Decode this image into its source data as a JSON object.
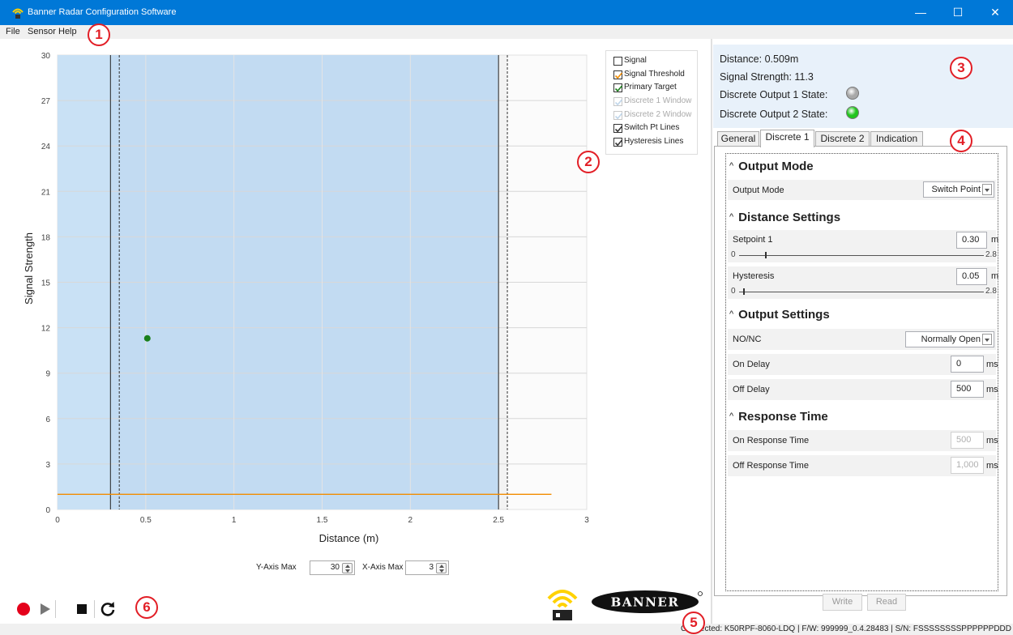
{
  "window": {
    "title": "Banner Radar Configuration Software",
    "minimize": "—",
    "maximize": "☐",
    "close": "✕"
  },
  "menu": [
    "File",
    "Sensor",
    "Help"
  ],
  "badges": [
    "1",
    "2",
    "3",
    "4",
    "5",
    "6"
  ],
  "chart_data": {
    "type": "scatter",
    "xlabel": "Distance (m)",
    "ylabel": "Signal Strength",
    "xlim": [
      0,
      3
    ],
    "ylim": [
      0,
      30
    ],
    "x_ticks": [
      "0",
      "0.5",
      "1",
      "1.5",
      "2",
      "2.5",
      "3"
    ],
    "y_ticks": [
      "0",
      "3",
      "6",
      "9",
      "12",
      "15",
      "18",
      "21",
      "24",
      "27",
      "30"
    ],
    "grid": true,
    "points": [
      {
        "x": 0.509,
        "y": 11.3,
        "color": "#1a7f1a"
      }
    ],
    "signal_threshold": {
      "value": 1.0,
      "x_range": [
        0,
        2.8
      ],
      "color": "#f28c00"
    },
    "window_range": [
      0.3,
      2.5
    ],
    "switch_point_lines": [
      0.3,
      2.5
    ],
    "hysteresis_lines": [
      0.35,
      2.55
    ],
    "window_color": "#c9e1f5"
  },
  "legend": [
    {
      "label": "Signal",
      "checked": false,
      "enabled": true,
      "check_color": "#333"
    },
    {
      "label": "Signal Threshold",
      "checked": true,
      "enabled": true,
      "check_color": "#f28c00"
    },
    {
      "label": "Primary Target",
      "checked": true,
      "enabled": true,
      "check_color": "#1a7f1a"
    },
    {
      "label": "Discrete 1 Window",
      "checked": true,
      "enabled": false,
      "check_color": "#c0d6ea"
    },
    {
      "label": "Discrete 2 Window",
      "checked": true,
      "enabled": false,
      "check_color": "#c0d6ea"
    },
    {
      "label": "Switch Pt Lines",
      "checked": true,
      "enabled": true,
      "check_color": "#333"
    },
    {
      "label": "Hysteresis Lines",
      "checked": true,
      "enabled": true,
      "check_color": "#333"
    }
  ],
  "axis_controls": {
    "y_label": "Y-Axis Max",
    "y_value": "30",
    "x_label": "X-Axis Max",
    "x_value": "3"
  },
  "status": {
    "distance": "Distance: 0.509m",
    "signal_strength": "Signal Strength:  11.3",
    "do1_label": "Discrete Output 1 State:",
    "do1_color": "#a8a8a8",
    "do2_label": "Discrete Output 2 State:",
    "do2_color": "#22c51e"
  },
  "tabs": [
    "General",
    "Discrete 1",
    "Discrete 2",
    "Indication"
  ],
  "active_tab": 1,
  "settings": {
    "output_mode": {
      "title": "Output Mode",
      "label": "Output Mode",
      "value": "Switch Point"
    },
    "distance": {
      "title": "Distance Settings",
      "setpoint_label": "Setpoint 1",
      "setpoint_value": "0.30",
      "setpoint_unit": "m",
      "setpoint_min": "0",
      "setpoint_max": "2.8",
      "setpoint_fraction": 0.107,
      "hysteresis_label": "Hysteresis",
      "hysteresis_value": "0.05",
      "hysteresis_unit": "m",
      "hysteresis_min": "0",
      "hysteresis_max": "2.8",
      "hysteresis_fraction": 0.018
    },
    "output": {
      "title": "Output Settings",
      "nonc_label": "NO/NC",
      "nonc_value": "Normally Open",
      "on_delay_label": "On Delay",
      "on_delay_value": "0",
      "on_delay_unit": "ms",
      "off_delay_label": "Off Delay",
      "off_delay_value": "500",
      "off_delay_unit": "ms"
    },
    "response": {
      "title": "Response Time",
      "on_label": "On Response Time",
      "on_value": "500",
      "on_unit": "ms",
      "off_label": "Off Response Time",
      "off_value": "1,000",
      "off_unit": "ms"
    }
  },
  "buttons": {
    "write": "Write",
    "read": "Read"
  },
  "logo_text": "BANNER",
  "statusbar": "Connected: K50RPF-8060-LDQ | F/W: 999999_0.4.28483 | S/N: FSSSSSSSSPPPPPPDDD"
}
